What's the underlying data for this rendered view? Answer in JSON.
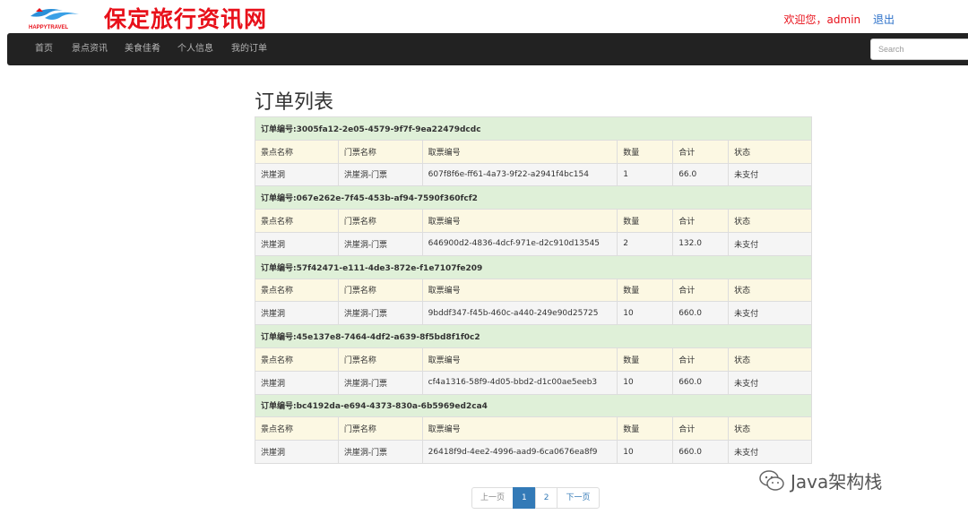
{
  "header": {
    "logo_caption": "HAPPYTRAVEL",
    "site_title": "保定旅行资讯网",
    "welcome": "欢迎您，admin",
    "logout": "退出"
  },
  "nav": {
    "items": [
      {
        "label": "首页"
      },
      {
        "label": "景点资讯"
      },
      {
        "label": "美食佳肴"
      },
      {
        "label": "个人信息"
      },
      {
        "label": "我的订单"
      }
    ],
    "search_placeholder": "Search"
  },
  "page_title": "订单列表",
  "columns": [
    "景点名称",
    "门票名称",
    "取票编号",
    "数量",
    "合计",
    "状态"
  ],
  "orders": [
    {
      "order_no": "订单编号:3005fa12-2e05-4579-9f7f-9ea22479dcdc",
      "row": [
        "洪崖洞",
        "洪崖洞-门票",
        "607f8f6e-ff61-4a73-9f22-a2941f4bc154",
        "1",
        "66.0",
        "未支付"
      ]
    },
    {
      "order_no": "订单编号:067e262e-7f45-453b-af94-7590f360fcf2",
      "row": [
        "洪崖洞",
        "洪崖洞-门票",
        "646900d2-4836-4dcf-971e-d2c910d13545",
        "2",
        "132.0",
        "未支付"
      ]
    },
    {
      "order_no": "订单编号:57f42471-e111-4de3-872e-f1e7107fe209",
      "row": [
        "洪崖洞",
        "洪崖洞-门票",
        "9bddf347-f45b-460c-a440-249e90d25725",
        "10",
        "660.0",
        "未支付"
      ]
    },
    {
      "order_no": "订单编号:45e137e8-7464-4df2-a639-8f5bd8f1f0c2",
      "row": [
        "洪崖洞",
        "洪崖洞-门票",
        "cf4a1316-58f9-4d05-bbd2-d1c00ae5eeb3",
        "10",
        "660.0",
        "未支付"
      ]
    },
    {
      "order_no": "订单编号:bc4192da-e694-4373-830a-6b5969ed2ca4",
      "row": [
        "洪崖洞",
        "洪崖洞-门票",
        "26418f9d-4ee2-4996-aad9-6ca0676ea8f9",
        "10",
        "660.0",
        "未支付"
      ]
    }
  ],
  "pagination": {
    "prev": "上一页",
    "pages": [
      "1",
      "2"
    ],
    "active": "1",
    "next": "下一页"
  },
  "watermark": "Java架构栈",
  "colors": {
    "title_red": "#e8101a",
    "nav_bg": "#222222",
    "order_head_bg": "#dff0d8",
    "col_head_bg": "#fcf8e3",
    "link_blue": "#337ab7"
  }
}
